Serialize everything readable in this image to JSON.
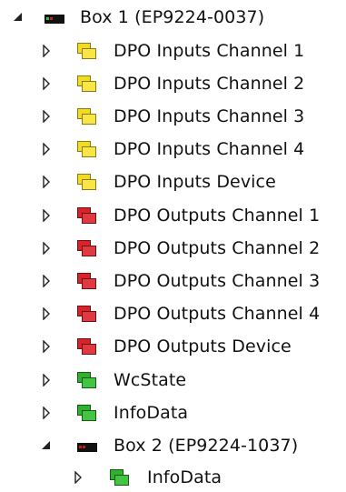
{
  "colors": {
    "input_icon": "#f3dc1f",
    "output_icon": "#d8232a",
    "state_icon": "#2fb12f",
    "box_icon": "#111111",
    "box_led": "#35c735",
    "box_led_red": "#c41e1e",
    "arrow": "#222222"
  },
  "tree": {
    "box1": {
      "label": "Box 1 (EP9224-0037)",
      "children": [
        {
          "label": "DPO Inputs Channel 1",
          "icon": "input-icon"
        },
        {
          "label": "DPO Inputs Channel 2",
          "icon": "input-icon"
        },
        {
          "label": "DPO Inputs Channel 3",
          "icon": "input-icon"
        },
        {
          "label": "DPO Inputs Channel 4",
          "icon": "input-icon"
        },
        {
          "label": "DPO Inputs Device",
          "icon": "input-icon"
        },
        {
          "label": "DPO Outputs Channel 1",
          "icon": "output-icon"
        },
        {
          "label": "DPO Outputs Channel 2",
          "icon": "output-icon"
        },
        {
          "label": "DPO Outputs Channel 3",
          "icon": "output-icon"
        },
        {
          "label": "DPO Outputs Channel 4",
          "icon": "output-icon"
        },
        {
          "label": "DPO Outputs Device",
          "icon": "output-icon"
        },
        {
          "label": "WcState",
          "icon": "state-icon"
        },
        {
          "label": "InfoData",
          "icon": "state-icon"
        }
      ]
    },
    "box2": {
      "label": "Box 2 (EP9224-1037)",
      "children": [
        {
          "label": "InfoData",
          "icon": "state-icon"
        }
      ]
    }
  }
}
